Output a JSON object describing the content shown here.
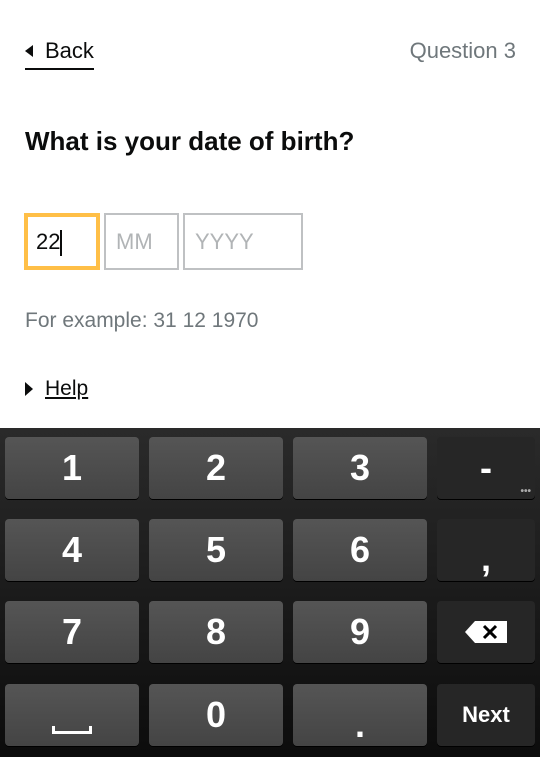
{
  "header": {
    "back_label": "Back",
    "question": "Question 3"
  },
  "title": "What is your date of birth?",
  "date": {
    "day_value": "22",
    "month_placeholder": "MM",
    "year_placeholder": "YYYY",
    "hint": "For example: 31 12 1970"
  },
  "help_label": "Help",
  "colors": {
    "focus": "#ffbf47",
    "keyboard": "#1a1a1a"
  },
  "keyboard": {
    "keys": [
      "1",
      "2",
      "3",
      "-",
      "4",
      "5",
      "6",
      ",",
      "7",
      "8",
      "9",
      "backspace-icon",
      "space-icon",
      "0",
      ".",
      "Next"
    ]
  }
}
